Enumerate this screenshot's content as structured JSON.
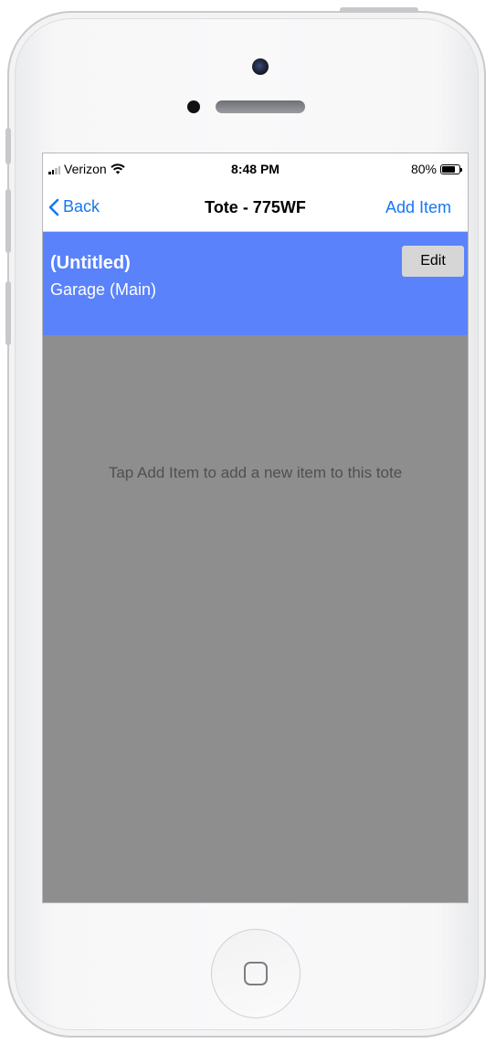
{
  "status_bar": {
    "carrier": "Verizon",
    "time": "8:48 PM",
    "battery_percent": "80%",
    "battery_level": 0.8
  },
  "nav": {
    "back_label": "Back",
    "title": "Tote - 775WF",
    "add_item_label": "Add Item"
  },
  "tote": {
    "name": "(Untitled)",
    "location": "Garage (Main)",
    "edit_label": "Edit"
  },
  "empty_message": "Tap Add Item to add a new item to this tote",
  "colors": {
    "header_bg": "#5a82fb",
    "link": "#1877f2",
    "empty_bg": "#8e8e8e"
  },
  "icons": [
    "signal-icon",
    "wifi-icon",
    "battery-icon",
    "chevron-left-icon",
    "home-button-icon"
  ]
}
